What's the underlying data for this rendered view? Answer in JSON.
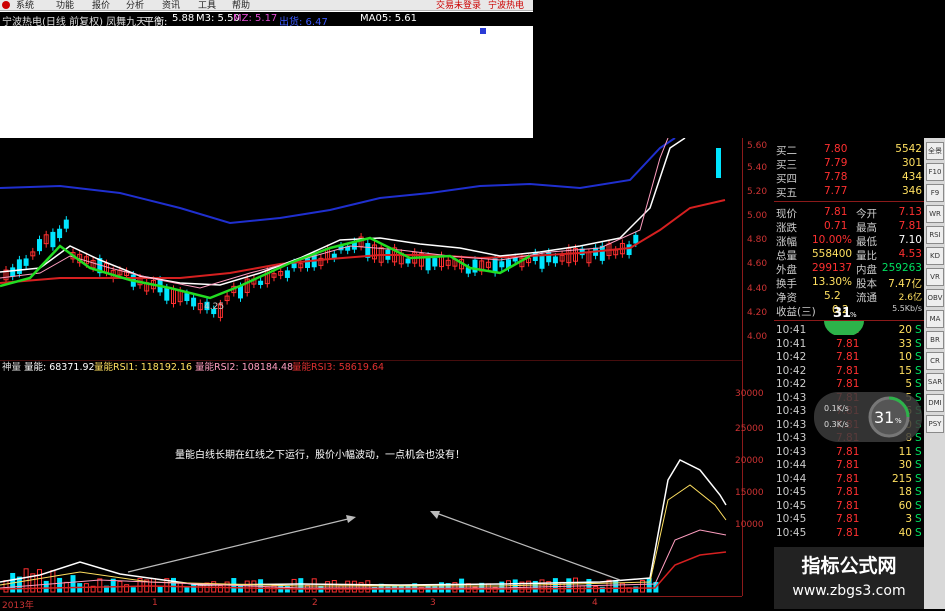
{
  "menu": {
    "items": [
      "系统",
      "功能",
      "报价",
      "分析",
      "资讯",
      "工具",
      "帮助"
    ],
    "right_links": [
      "交易未登录",
      "宁波热电"
    ]
  },
  "title_row": {
    "stock": "宁波热电(日线 前复权) 凤舞九天",
    "pingheng_label": "平衡:",
    "pingheng_value": "5.88",
    "m3": "M3: 5.50",
    "mz": "MZ: 5.17",
    "blue": "出货: 6.47",
    "ma05": "MA05: 5.61"
  },
  "price_axis": [
    "5.60",
    "5.40",
    "5.20",
    "5.00",
    "4.80",
    "4.60",
    "4.40",
    "4.20",
    "4.00"
  ],
  "low_label": "4.25",
  "indicator_bar": {
    "name": "神量",
    "vol": "量能: 68371.92",
    "rsi1": "量能RSI1: 118192.16",
    "rsi2": "量能RSI2: 108184.48",
    "rsi3": "量能RSI3: 58619.64"
  },
  "vol_axis": [
    "30000",
    "25000",
    "20000",
    "15000",
    "10000"
  ],
  "annotation": "量能白线长期在红线之下运行，股价小幅波动，一点机会也没有！",
  "x_axis": [
    "2013年",
    "1",
    "2",
    "3",
    "4"
  ],
  "quote_rows": [
    {
      "l": "买二",
      "v": "7.80",
      "r": "5542"
    },
    {
      "l": "买三",
      "v": "7.79",
      "r": "301"
    },
    {
      "l": "买四",
      "v": "7.78",
      "r": "434"
    },
    {
      "l": "买五",
      "v": "7.77",
      "r": "346"
    }
  ],
  "stat_rows": [
    {
      "l1": "现价",
      "v1": "7.81",
      "l2": "今开",
      "v2": "7.13"
    },
    {
      "l1": "涨跌",
      "v1": "0.71",
      "l2": "最高",
      "v2": "7.81"
    },
    {
      "l1": "涨幅",
      "v1": "10.00%",
      "l2": "最低",
      "v2": "7.10"
    },
    {
      "l1": "总量",
      "v1": "558400",
      "l2": "量比",
      "v2": "4.53"
    },
    {
      "l1": "外盘",
      "v1": "299137",
      "l2": "内盘",
      "v2": "259263"
    },
    {
      "l1": "换手",
      "v1": "13.30%",
      "l2": "股本",
      "v2": "7.47亿"
    },
    {
      "l1": "净资",
      "v1": "5.2",
      "l2": "流通",
      "v2": "2.6亿"
    },
    {
      "l1": "收益(三)",
      "v1": "0.2",
      "l2": "",
      "v2": "5.5Kb/s"
    }
  ],
  "ticks": [
    {
      "t": "10:41",
      "p": "7.81",
      "v": "20",
      "s": "S"
    },
    {
      "t": "10:41",
      "p": "7.81",
      "v": "33",
      "s": "S"
    },
    {
      "t": "10:42",
      "p": "7.81",
      "v": "10",
      "s": "S"
    },
    {
      "t": "10:42",
      "p": "7.81",
      "v": "15",
      "s": "S"
    },
    {
      "t": "10:42",
      "p": "7.81",
      "v": "5",
      "s": "S"
    },
    {
      "t": "10:43",
      "p": "7.81",
      "v": "5",
      "s": "S"
    },
    {
      "t": "10:43",
      "p": "7.81",
      "v": "6",
      "s": "S"
    },
    {
      "t": "10:43",
      "p": "7.81",
      "v": "10",
      "s": "S"
    },
    {
      "t": "10:43",
      "p": "7.81",
      "v": "8",
      "s": "S"
    },
    {
      "t": "10:43",
      "p": "7.81",
      "v": "11",
      "s": "S"
    },
    {
      "t": "10:44",
      "p": "7.81",
      "v": "30",
      "s": "S"
    },
    {
      "t": "10:44",
      "p": "7.81",
      "v": "215",
      "s": "S"
    },
    {
      "t": "10:45",
      "p": "7.81",
      "v": "18",
      "s": "S"
    },
    {
      "t": "10:45",
      "p": "7.81",
      "v": "60",
      "s": "S"
    },
    {
      "t": "10:45",
      "p": "7.81",
      "v": "3",
      "s": "S"
    },
    {
      "t": "10:45",
      "p": "7.81",
      "v": "40",
      "s": "S"
    }
  ],
  "gauge_small": {
    "value": "31",
    "unit": "%"
  },
  "gauge_big": {
    "value": "31",
    "unit": "%",
    "up": "0.1K/s",
    "down": "0.3K/s"
  },
  "toolbar": [
    "全景",
    "F10",
    "F9",
    "WR",
    "RSI",
    "KD",
    "VR",
    "OBV",
    "MA",
    "BR",
    "CR",
    "SAR",
    "DMI",
    "PSY"
  ],
  "watermark": {
    "title": "指标公式网",
    "url": "www.zbgs3.com"
  },
  "colors": {
    "up": "#ff3030",
    "down": "#00e5ff",
    "white_line": "#ffffff",
    "red_line": "#d62020",
    "green_line": "#22dd22",
    "blue_line": "#1f2fcf",
    "pink_line": "#ff9ec0"
  }
}
